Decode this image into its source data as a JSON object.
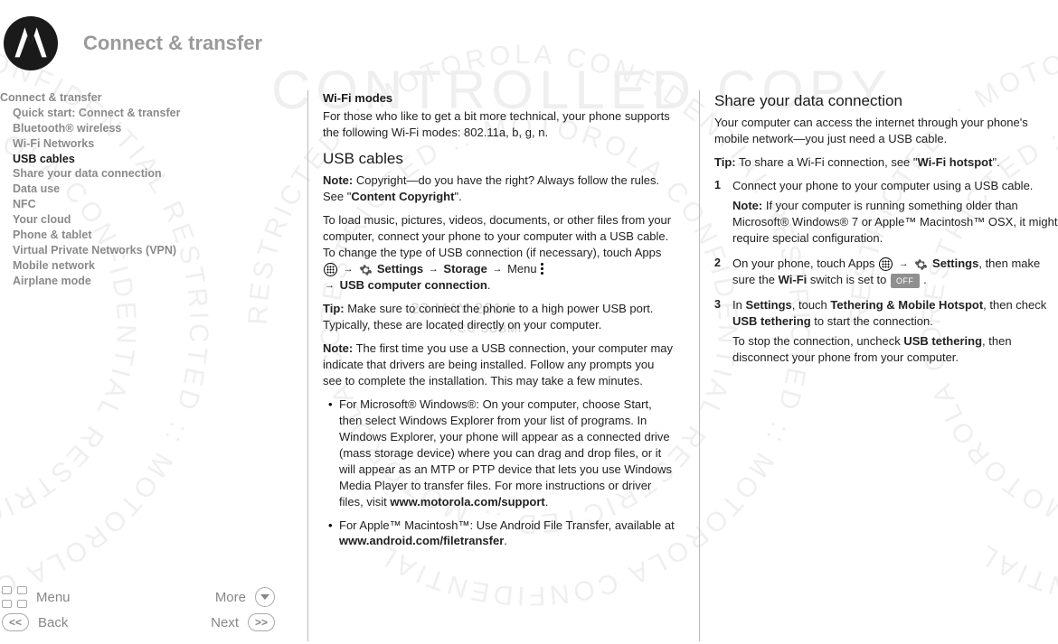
{
  "header": {
    "title": "Connect & transfer"
  },
  "watermark": {
    "ring_text": "RESTRICTED :: MOTOROLA CONFIDENTIAL RESTRICTED :: MOTOROLA CONFIDENTIAL",
    "center_line": "CONTROLLED COPY",
    "date": "23 MAY 2014",
    "sub": "FCC SUBMIT"
  },
  "toc": [
    {
      "label": "Connect & transfer",
      "sub": false
    },
    {
      "label": "Quick start: Connect & transfer",
      "sub": true
    },
    {
      "label": "Bluetooth® wireless",
      "sub": true
    },
    {
      "label": "Wi-Fi Networks",
      "sub": true
    },
    {
      "label": "USB cables",
      "sub": true,
      "current": true
    },
    {
      "label": "Share your data connection",
      "sub": true
    },
    {
      "label": "Data use",
      "sub": true
    },
    {
      "label": "NFC",
      "sub": true
    },
    {
      "label": "Your cloud",
      "sub": true
    },
    {
      "label": "Phone & tablet",
      "sub": true
    },
    {
      "label": "Virtual Private Networks (VPN)",
      "sub": true
    },
    {
      "label": "Mobile network",
      "sub": true
    },
    {
      "label": "Airplane mode",
      "sub": true
    }
  ],
  "nav": {
    "menu": "Menu",
    "more": "More",
    "back": "Back",
    "next": "Next"
  },
  "column_mid": {
    "wifi_modes_h": "Wi-Fi modes",
    "wifi_modes_p": "For those who like to get a bit more technical, your phone supports the following Wi-Fi modes: 802.11a, b, g, n.",
    "usb_h": "USB cables",
    "usb_note_prefix": "Note:",
    "usb_note": "Copyright—do you have the right? Always follow the rules. See \"",
    "usb_note_link": "Content Copyright",
    "usb_note_end": "\".",
    "usb_p1a": "To load music, pictures, videos, documents, or other files from your computer, connect your phone to your computer with a USB cable. To change the type of USB connection (if necessary), touch Apps ",
    "usb_p1b_settings": "Settings",
    "usb_p1c_storage": "Storage",
    "usb_p1d": " Menu  ",
    "usb_p1e_usb": "USB computer connection",
    "usb_tip_prefix": "Tip:",
    "usb_tip": "Make sure to connect the phone to a high power USB port. Typically, these are located directly on your computer.",
    "usb_note2_prefix": "Note:",
    "usb_note2": "The first time you use a USB connection, your computer may indicate that drivers are being installed. Follow any prompts you see to complete the installation. This may take a few minutes.",
    "bullet1a": "For Microsoft® Windows®: On your computer, choose Start, then select Windows Explorer from your list of programs. In Windows Explorer, your phone will appear as a connected drive (mass storage device) where you can drag and drop files, or it will appear as an MTP or PTP device that lets you use Windows Media Player to transfer files. For more instructions or driver files, visit ",
    "bullet1_link": "www.motorola.com/support",
    "bullet2a": "For Apple™ Macintosh™: Use Android File Transfer, available at ",
    "bullet2_link": "www.android.com/filetransfer"
  },
  "column_right": {
    "share_h": "Share your data connection",
    "share_p": "Your computer can access the internet through your phone's mobile network—you just need a USB cable.",
    "share_tip_prefix": "Tip:",
    "share_tip_a": "To share a Wi-Fi connection, see \"",
    "share_tip_link": "Wi-Fi hotspot",
    "share_tip_b": "\".",
    "step1": "Connect your phone to your computer using a USB cable.",
    "step1_note_prefix": "Note:",
    "step1_note": "If your computer is running something older than Microsoft® Windows® 7 or Apple™ Macintosh™ OSX, it might require special configuration.",
    "step2a": "On your phone, touch Apps ",
    "step2_settings": "Settings",
    "step2b": ", then make sure the ",
    "step2_wifi": "Wi-Fi",
    "step2c": " switch is set to ",
    "step3a": "In ",
    "step3_settings": "Settings",
    "step3b": ", touch ",
    "step3_tmh": "Tethering & Mobile Hotspot",
    "step3c": ", then check ",
    "step3_tether": "USB tethering",
    "step3d": " to start the connection.",
    "step3_p2a": "To stop the connection, uncheck ",
    "step3_p2_tether": "USB tethering",
    "step3_p2b": ", then disconnect your phone from your computer.",
    "off_label": "OFF"
  }
}
